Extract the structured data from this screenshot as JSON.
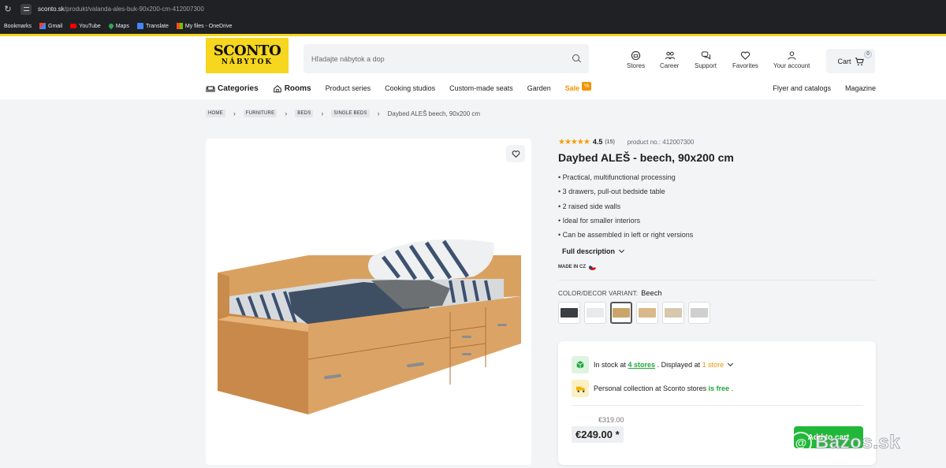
{
  "browser": {
    "url_host": "sconto.sk",
    "url_path": "/produkt/valanda-ales-buk-90x200-cm-412007300",
    "bookmarks": [
      "Bookmarks",
      "Gmail",
      "YouTube",
      "Maps",
      "Translate",
      "My files - OneDrive"
    ]
  },
  "header": {
    "logo_line1": "SCONTO",
    "logo_line2": "NÁBYTOK",
    "search_placeholder": "Hľadajte nábytok a dop",
    "icons": [
      {
        "label": "Stores",
        "icon": "store-icon"
      },
      {
        "label": "Career",
        "icon": "people-icon"
      },
      {
        "label": "Support",
        "icon": "chat-icon"
      },
      {
        "label": "Favorites",
        "icon": "heart-icon"
      },
      {
        "label": "Your account",
        "icon": "user-icon"
      }
    ],
    "cart_label": "Cart",
    "cart_count": "0"
  },
  "nav": {
    "categories": "Categories",
    "rooms": "Rooms",
    "items": [
      "Product series",
      "Cooking studios",
      "Custom-made seats",
      "Garden"
    ],
    "sale": "Sale",
    "sale_badge": "%",
    "right": [
      "Flyer and catalogs",
      "Magazine"
    ]
  },
  "breadcrumb": {
    "crumbs": [
      "HOME",
      "FURNITURE",
      "BEDS",
      "SINGLE BEDS"
    ],
    "current": "Daybed ALEŠ beech, 90x200 cm"
  },
  "product": {
    "stars": "★★★★★",
    "rating": "4.5",
    "rating_count": "(15)",
    "product_no": "product no.: 412007300",
    "title": "Daybed ALEŠ - beech, 90x200 cm",
    "features": [
      "• Practical, multifunctional processing",
      "• 3 drawers, pull-out bedside table",
      "• 2 raised side walls",
      "• Ideal for smaller interiors",
      "• Can be assembled in left or right versions"
    ],
    "full_description": "Full description",
    "made_in": "MADE IN CZ",
    "variant_label": "COLOR/DECOR VARIANT:",
    "variant_value": "Beech",
    "swatches": [
      {
        "color": "#3a3d42",
        "selected": false
      },
      {
        "color": "#e9eaec",
        "selected": false
      },
      {
        "color": "#c9a56b",
        "selected": true
      },
      {
        "color": "#d9b88a",
        "selected": false
      },
      {
        "color": "#d6c7ad",
        "selected": false
      },
      {
        "color": "#cfcfcf",
        "selected": false
      }
    ]
  },
  "stock": {
    "in_stock_prefix": "In stock at",
    "stores_link": "4 stores",
    "displayed_at": ". Displayed at",
    "store_link": "1 store",
    "collection_prefix": "Personal collection at Sconto stores",
    "is_free": "is free",
    "collection_suffix": ".",
    "old_price": "€319.00",
    "price": "€249.00 *",
    "add_to_cart": "Add to cart"
  },
  "watermark": {
    "symbol": "@",
    "text": "Bazos.sk"
  },
  "colors": {
    "brand_yellow": "#f6d61e",
    "green": "#21b83a",
    "orange": "#f29400"
  }
}
